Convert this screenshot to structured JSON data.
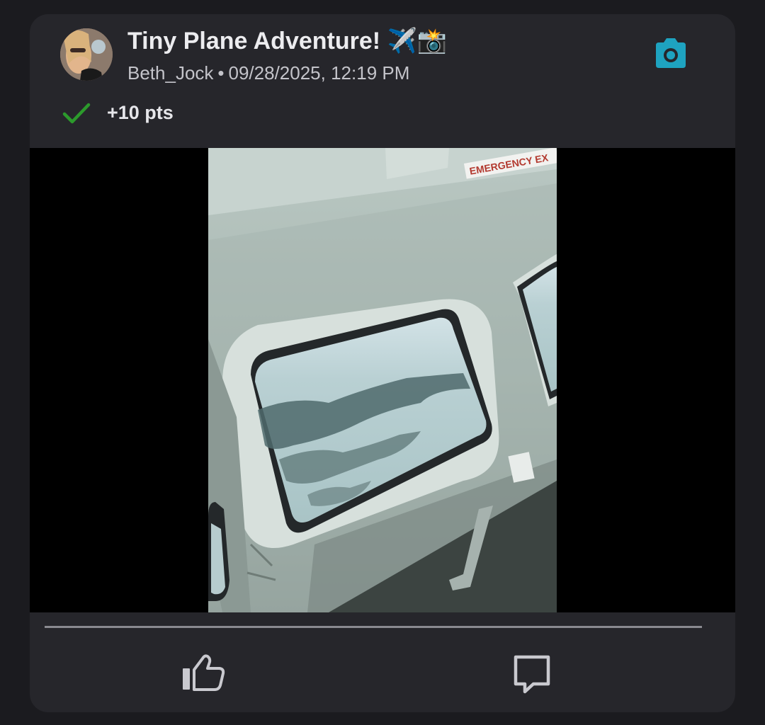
{
  "post": {
    "title": "Tiny Plane Adventure! ✈️📸",
    "author": "Beth_Jock",
    "separator": "•",
    "timestamp": "09/28/2025, 12:19 PM",
    "points": "+10 pts",
    "photo_text": "EMERGENCY EX"
  },
  "icons": {
    "post_type": "camera-icon",
    "status": "checkmark-icon",
    "like": "thumbs-up-icon",
    "comment": "comment-icon"
  },
  "colors": {
    "background": "#1b1b1f",
    "card": "#26262b",
    "accent": "#1ea3c0",
    "success": "#2c9a2c",
    "title_text": "#ececef",
    "meta_text": "#c4c4ca"
  }
}
